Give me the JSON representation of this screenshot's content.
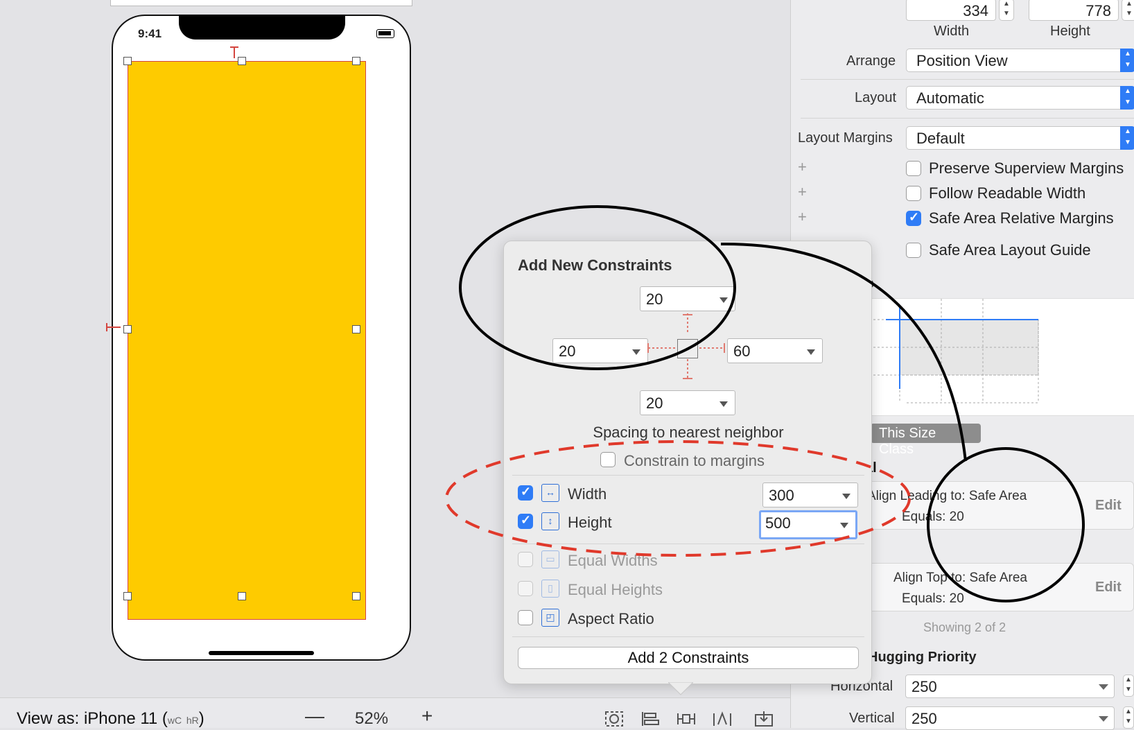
{
  "phone": {
    "time": "9:41"
  },
  "bottombar": {
    "view_as": "View as: iPhone 11 (",
    "size_w": "wC",
    "size_h": "hR",
    "close_paren": ")",
    "zoom": "52%",
    "zoom_out": "—",
    "zoom_in": "+"
  },
  "inspector": {
    "width_value": "334",
    "height_value": "778",
    "width_label": "Width",
    "height_label": "Height",
    "arrange_label": "Arrange",
    "arrange_value": "Position View",
    "layout_label": "Layout",
    "layout_value": "Automatic",
    "margins_label": "Layout Margins",
    "margins_value": "Default",
    "checkboxes": [
      {
        "label": "Preserve Superview Margins",
        "checked": false
      },
      {
        "label": "Follow Readable Width",
        "checked": false
      },
      {
        "label": "Safe Area Relative Margins",
        "checked": true
      },
      {
        "label": "Safe Area Layout Guide",
        "checked": false
      }
    ],
    "constraints_heading_fragment": "ts",
    "size_class_pill": "This Size Class",
    "section_fragment": "al",
    "constraint1": {
      "line1": "Align Leading to:  Safe Area",
      "line2": "Equals:  20",
      "edit": "Edit"
    },
    "constraint2": {
      "line1": "Align Top to:  Safe Area",
      "line2": "Equals:  20",
      "edit": "Edit"
    },
    "showing": "Showing 2 of 2",
    "hugging_heading": "Hugging Priority",
    "horizontal_label": "Horizontal",
    "horizontal_value": "250",
    "vertical_label": "Vertical",
    "vertical_value": "250"
  },
  "popover": {
    "title": "Add New Constraints",
    "top": "20",
    "left": "20",
    "right": "60",
    "bottom": "20",
    "spacing_label": "Spacing to nearest neighbor",
    "constrain_margins": "Constrain to margins",
    "width_label": "Width",
    "width_value": "300",
    "height_label": "Height",
    "height_value": "500",
    "equal_widths": "Equal Widths",
    "equal_heights": "Equal Heights",
    "aspect_ratio": "Aspect Ratio",
    "add_button": "Add 2 Constraints"
  },
  "colors": {
    "accent": "#2f7cf6",
    "yellow_view": "#fecb00",
    "annotation_red": "#e0392b"
  }
}
